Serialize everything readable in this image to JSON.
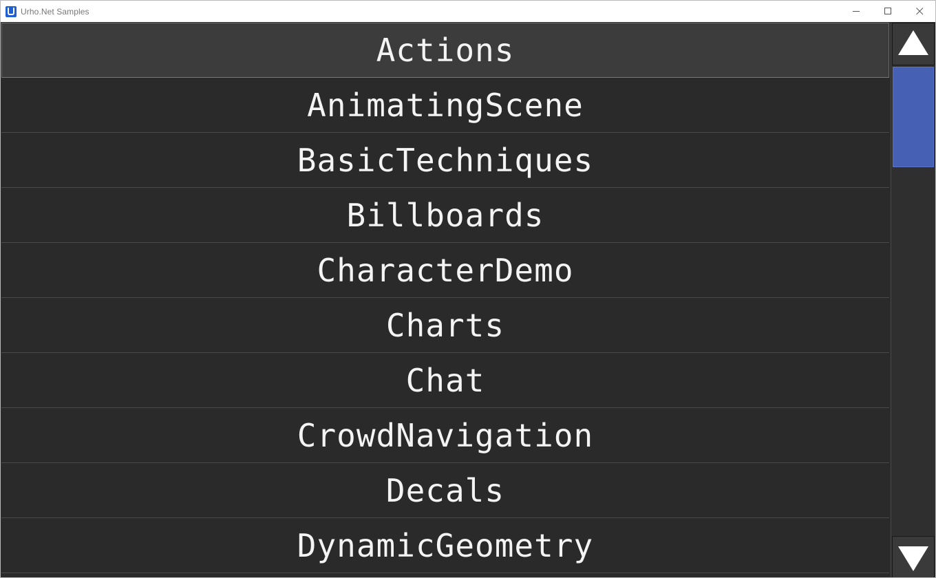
{
  "window": {
    "title": "Urho.Net Samples",
    "icon": "urho-logo-icon"
  },
  "samples": [
    {
      "label": "Actions",
      "selected": true
    },
    {
      "label": "AnimatingScene"
    },
    {
      "label": "BasicTechniques"
    },
    {
      "label": "Billboards"
    },
    {
      "label": "CharacterDemo"
    },
    {
      "label": "Charts"
    },
    {
      "label": "Chat"
    },
    {
      "label": "CrowdNavigation"
    },
    {
      "label": "Decals"
    },
    {
      "label": "DynamicGeometry"
    }
  ],
  "scrollbar": {
    "up_icon": "triangle-up-icon",
    "down_icon": "triangle-down-icon",
    "thumb_color": "#4660b4"
  },
  "colors": {
    "background": "#2a2a2a",
    "selected_background": "#3c3c3c",
    "text": "#f4f4f4"
  }
}
